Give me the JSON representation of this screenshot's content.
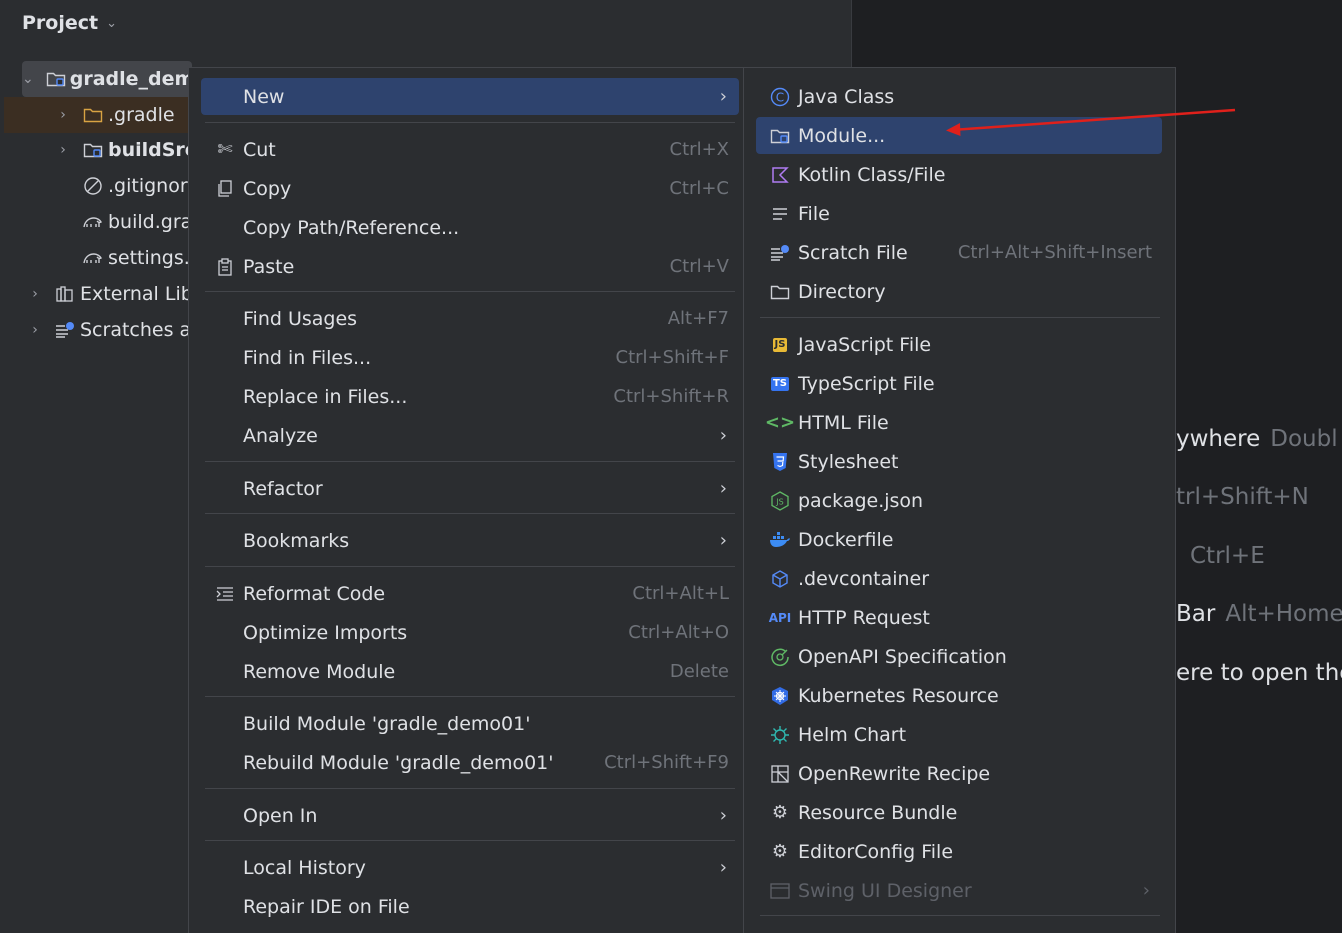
{
  "panel": {
    "title": "Project"
  },
  "tree": [
    {
      "label": "gradle_dem",
      "icon": "module-folder-icon"
    },
    {
      "label": ".gradle",
      "icon": "folder-icon"
    },
    {
      "label": "buildSrc",
      "icon": "module-folder-icon"
    },
    {
      "label": ".gitignor",
      "icon": "ignored-file-icon"
    },
    {
      "label": "build.gra",
      "icon": "gradle-file-icon"
    },
    {
      "label": "settings.",
      "icon": "gradle-file-icon"
    },
    {
      "label": "External Lib",
      "icon": "library-icon"
    },
    {
      "label": "Scratches a",
      "icon": "scratches-icon"
    }
  ],
  "hints": [
    {
      "text": "ywhere",
      "key": "Doubl"
    },
    {
      "text": "",
      "key": "trl+Shift+N"
    },
    {
      "text": "",
      "key": "Ctrl+E"
    },
    {
      "text": "Bar",
      "key": "Alt+Home"
    },
    {
      "text": "ere to open the",
      "key": ""
    }
  ],
  "context_menu": {
    "items": [
      {
        "label": "New",
        "shortcut": "",
        "submenu": true,
        "icon": ""
      },
      {
        "label": "Cut",
        "shortcut": "Ctrl+X",
        "icon": "scissors-icon"
      },
      {
        "label": "Copy",
        "shortcut": "Ctrl+C",
        "icon": "copy-icon"
      },
      {
        "label": "Copy Path/Reference...",
        "shortcut": "",
        "icon": ""
      },
      {
        "label": "Paste",
        "shortcut": "Ctrl+V",
        "icon": "paste-icon"
      },
      {
        "label": "Find Usages",
        "shortcut": "Alt+F7"
      },
      {
        "label": "Find in Files...",
        "shortcut": "Ctrl+Shift+F"
      },
      {
        "label": "Replace in Files...",
        "shortcut": "Ctrl+Shift+R"
      },
      {
        "label": "Analyze",
        "submenu": true
      },
      {
        "label": "Refactor",
        "submenu": true
      },
      {
        "label": "Bookmarks",
        "submenu": true
      },
      {
        "label": "Reformat Code",
        "shortcut": "Ctrl+Alt+L",
        "icon": "reformat-icon"
      },
      {
        "label": "Optimize Imports",
        "shortcut": "Ctrl+Alt+O"
      },
      {
        "label": "Remove Module",
        "shortcut": "Delete"
      },
      {
        "label": "Build Module 'gradle_demo01'",
        "shortcut": ""
      },
      {
        "label": "Rebuild Module 'gradle_demo01'",
        "shortcut": "Ctrl+Shift+F9"
      },
      {
        "label": "Open In",
        "submenu": true
      },
      {
        "label": "Local History",
        "submenu": true
      },
      {
        "label": "Repair IDE on File",
        "shortcut": ""
      }
    ]
  },
  "new_submenu": {
    "items": [
      {
        "label": "Java Class",
        "shortcut": "",
        "icon": "java-class-icon"
      },
      {
        "label": "Module...",
        "shortcut": "",
        "icon": "module-icon"
      },
      {
        "label": "Kotlin Class/File",
        "shortcut": "",
        "icon": "kotlin-icon"
      },
      {
        "label": "File",
        "shortcut": "",
        "icon": "file-icon"
      },
      {
        "label": "Scratch File",
        "shortcut": "Ctrl+Alt+Shift+Insert",
        "icon": "scratch-file-icon"
      },
      {
        "label": "Directory",
        "shortcut": "",
        "icon": "directory-icon"
      },
      {
        "label": "JavaScript File",
        "icon": "javascript-icon",
        "badge": "JS"
      },
      {
        "label": "TypeScript File",
        "icon": "typescript-icon",
        "badge": "TS"
      },
      {
        "label": "HTML File",
        "icon": "html-icon"
      },
      {
        "label": "Stylesheet",
        "icon": "css-icon"
      },
      {
        "label": "package.json",
        "icon": "nodejs-icon"
      },
      {
        "label": "Dockerfile",
        "icon": "docker-icon"
      },
      {
        "label": ".devcontainer",
        "icon": "devcontainer-icon"
      },
      {
        "label": "HTTP Request",
        "icon": "api-icon",
        "badge": "API"
      },
      {
        "label": "OpenAPI Specification",
        "icon": "openapi-icon"
      },
      {
        "label": "Kubernetes Resource",
        "icon": "kubernetes-icon"
      },
      {
        "label": "Helm Chart",
        "icon": "helm-icon"
      },
      {
        "label": "OpenRewrite Recipe",
        "icon": "openrewrite-icon"
      },
      {
        "label": "Resource Bundle",
        "icon": "gear-icon"
      },
      {
        "label": "EditorConfig File",
        "icon": "gear-icon"
      },
      {
        "label": "Swing UI Designer",
        "icon": "swing-icon",
        "submenu": true
      }
    ]
  },
  "colors": {
    "highlight": "#2e436e",
    "annotation_arrow": "#e0201b"
  }
}
